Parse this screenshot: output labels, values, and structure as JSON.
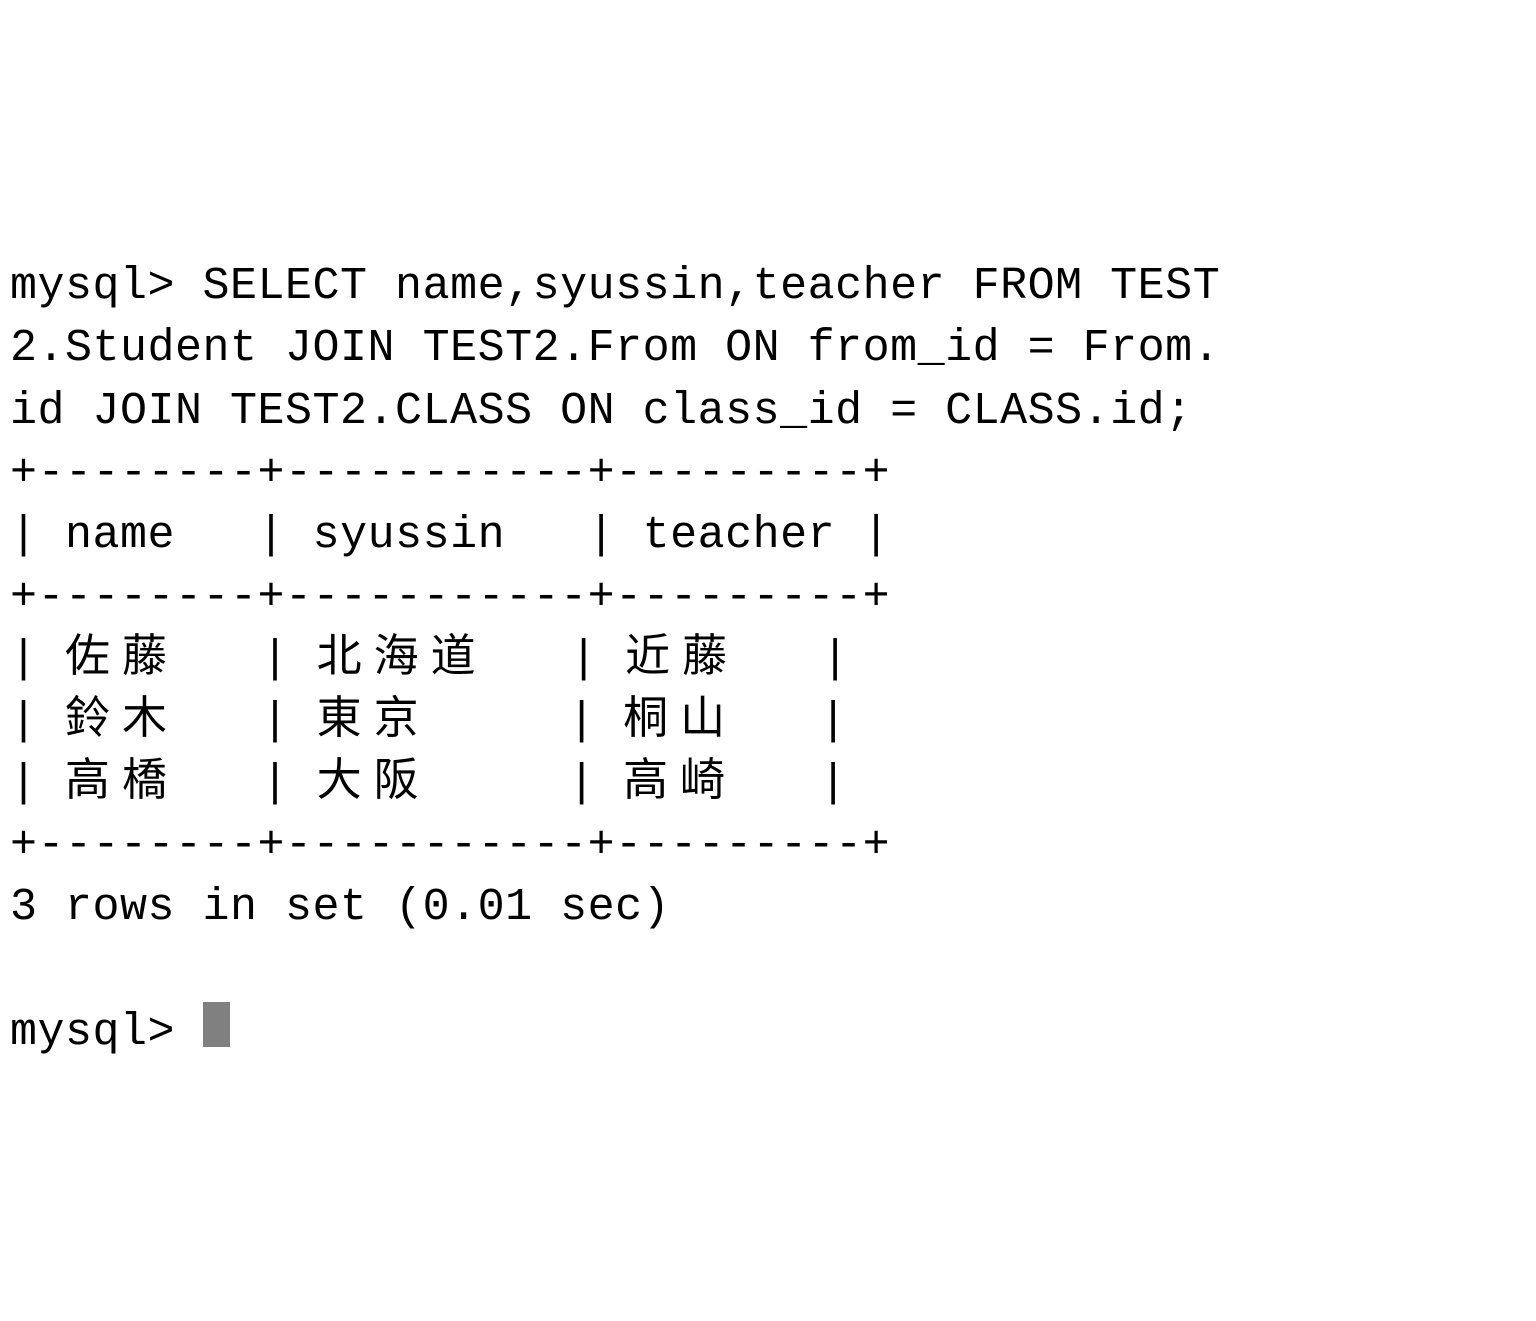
{
  "terminal": {
    "prompt": "mysql> ",
    "query_line1": "mysql> SELECT name,syussin,teacher FROM TEST",
    "query_line2": "2.Student JOIN TEST2.From ON from_id = From.",
    "query_line3": "id JOIN TEST2.CLASS ON class_id = CLASS.id;",
    "border": "+--------+-----------+---------+",
    "header_pre": "| ",
    "col1_header": "name",
    "header_mid1": "   | ",
    "col2_header": "syussin",
    "header_mid2": "   | ",
    "col3_header": "teacher",
    "header_end": " |",
    "row_pre": "| ",
    "row_mid1": "   | ",
    "row_mid2": "   | ",
    "row_end": "   |",
    "r1c1": "佐藤",
    "r1c2": "北海道",
    "r1c3": "近藤",
    "r2c1": "鈴木",
    "r2c2": "東京",
    "r2c2_pad": "     | ",
    "r2c3": "桐山",
    "r3c1": "高橋",
    "r3c2": "大阪",
    "r3c2_pad": "     | ",
    "r3c3": "高崎",
    "footer": "3 rows in set (0.01 sec)",
    "blank": ""
  }
}
